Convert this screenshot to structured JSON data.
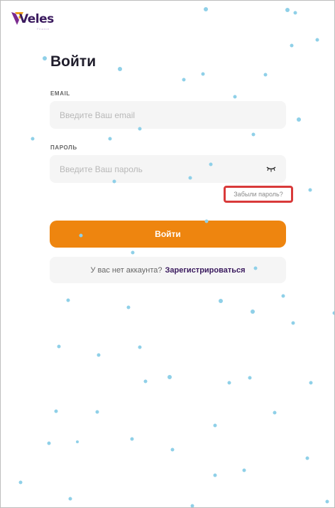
{
  "brand": {
    "name": "Veles",
    "tagline": "Finance"
  },
  "page": {
    "title": "Войти"
  },
  "email": {
    "label": "EMAIL",
    "placeholder": "Введите Ваш email",
    "value": ""
  },
  "password": {
    "label": "ПАРОЛЬ",
    "placeholder": "Введите Ваш пароль",
    "value": ""
  },
  "forgot_label": "Забыли пароль?",
  "submit_label": "Войти",
  "signup": {
    "prompt": "У вас нет аккаунта?",
    "link": "Зарегистрироваться"
  },
  "colors": {
    "accent": "#ee850f",
    "brand": "#3a1a5e",
    "dots": "#8fd0e8",
    "highlight": "#d93a3a"
  }
}
